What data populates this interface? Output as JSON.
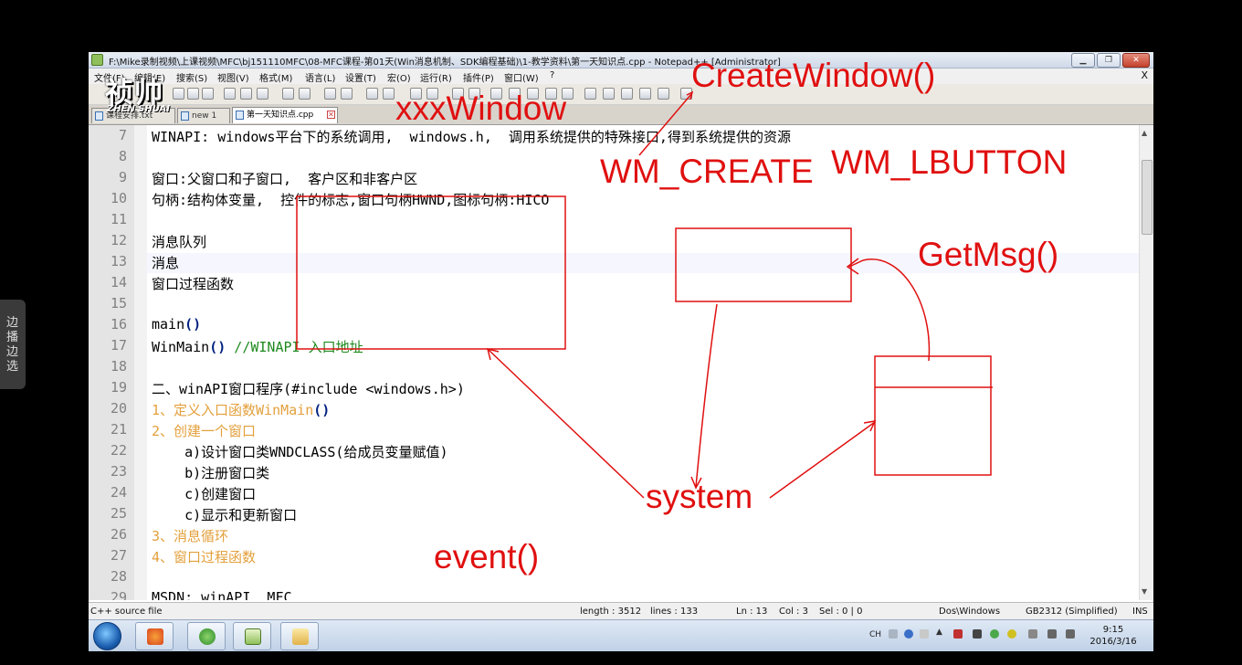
{
  "window": {
    "title": "F:\\Mike录制视频\\上课视频\\MFC\\bj151110MFC\\08-MFC课程-第01天(Win消息机制、SDK编程基础)\\1-教学资料\\第一天知识点.cpp - Notepad++ [Administrator]",
    "min_label": "▁",
    "max_label": "❐",
    "close_label": "✕"
  },
  "menu": {
    "items": [
      "文件(F)",
      "编辑(E)",
      "搜索(S)",
      "视图(V)",
      "格式(M)",
      "语言(L)",
      "设置(T)",
      "宏(O)",
      "运行(R)",
      "插件(P)",
      "窗口(W)",
      "?"
    ],
    "close_x": "X"
  },
  "tabs": [
    {
      "label": "课程安排.txt",
      "active": false
    },
    {
      "label": "new 1",
      "active": false
    },
    {
      "label": "第一天知识点.cpp",
      "active": true
    }
  ],
  "editor": {
    "lines": [
      {
        "num": "7",
        "text": "WINAPI: windows平台下的系统调用,  windows.h,  调用系统提供的特殊接口,得到系统提供的资源",
        "style": "plain"
      },
      {
        "num": "8",
        "text": "",
        "style": "plain"
      },
      {
        "num": "9",
        "text": "窗口:父窗口和子窗口,  客户区和非客户区",
        "style": "plain"
      },
      {
        "num": "10",
        "text": "句柄:结构体变量,  控件的标志,窗口句柄HWND,图标句柄:HICO",
        "style": "plain"
      },
      {
        "num": "11",
        "text": "",
        "style": "plain"
      },
      {
        "num": "12",
        "text": "消息队列",
        "style": "plain"
      },
      {
        "num": "13",
        "text": "消息",
        "style": "plain"
      },
      {
        "num": "14",
        "text": "窗口过程函数",
        "style": "plain"
      },
      {
        "num": "15",
        "text": "",
        "style": "plain"
      },
      {
        "num": "16",
        "text": "main",
        "suffix": "()",
        "style": "plain"
      },
      {
        "num": "17",
        "text": "WinMain",
        "suffix": "()",
        "comment": " //WINAPI 入口地址",
        "style": "plain"
      },
      {
        "num": "18",
        "text": "",
        "style": "plain"
      },
      {
        "num": "19",
        "text": "二、winAPI窗口程序(#include <windows.h>)",
        "style": "plain"
      },
      {
        "num": "20",
        "text": "1、定义入口函数WinMain",
        "suffix": "()",
        "style": "orange"
      },
      {
        "num": "21",
        "text": "2、创建一个窗口",
        "style": "orange"
      },
      {
        "num": "22",
        "text": "    a)设计窗口类WNDCLASS(给成员变量赋值)",
        "style": "plain"
      },
      {
        "num": "23",
        "text": "    b)注册窗口类",
        "style": "plain"
      },
      {
        "num": "24",
        "text": "    c)创建窗口",
        "style": "plain"
      },
      {
        "num": "25",
        "text": "    c)显示和更新窗口",
        "style": "plain"
      },
      {
        "num": "26",
        "text": "3、消息循环",
        "style": "orange"
      },
      {
        "num": "27",
        "text": "4、窗口过程函数",
        "style": "orange"
      },
      {
        "num": "28",
        "text": "",
        "style": "plain"
      },
      {
        "num": "29",
        "text": "MSDN: winAPI  MFC",
        "style": "plain"
      }
    ]
  },
  "status": {
    "file_type": "C++ source file",
    "length": "length : 3512",
    "lines": "lines : 133",
    "ln": "Ln : 13",
    "col": "Col : 3",
    "sel": "Sel : 0 | 0",
    "eol": "Dos\\Windows",
    "encoding": "GB2312 (Simplified)",
    "mode": "INS"
  },
  "taskbar": {
    "lang": "CH",
    "time": "9:15",
    "date": "2016/3/16"
  },
  "side_tab": {
    "text": "边播边选"
  },
  "logo": {
    "main": "祯帅",
    "sub": "ZHEN SHUAI"
  },
  "annotations": {
    "create_window": "CreateWindow()",
    "xxx_window": "xxxWindow",
    "wm_create": "WM_CREATE",
    "wm_lbutton": "WM_LBUTTON",
    "get_msg": "GetMsg()",
    "system": "system",
    "event": "event()"
  },
  "colors": {
    "annotation_red": "#e01010",
    "keyword_orange": "#e3a03c",
    "comment_green": "#1f8a1f"
  }
}
